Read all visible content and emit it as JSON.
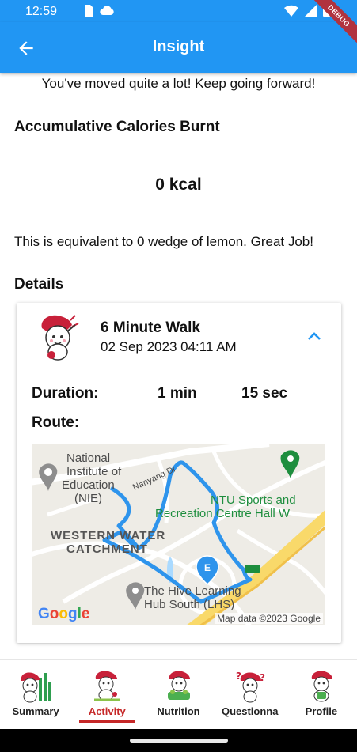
{
  "status_bar": {
    "time": "12:59"
  },
  "app_bar": {
    "title": "Insight",
    "debug_banner": "DEBUG"
  },
  "insight": {
    "motivation": "You've moved quite a lot! Keep going forward!",
    "calories_heading": "Accumulative Calories Burnt",
    "calories_value": "0 kcal",
    "equivalent_text": "This is equivalent to 0 wedge of lemon. Great Job!",
    "details_heading": "Details"
  },
  "activity": {
    "name": "6 Minute Walk",
    "datetime": "02 Sep 2023 04:11 AM",
    "duration_label": "Duration:",
    "duration_min": "1 min",
    "duration_sec": "15 sec",
    "route_label": "Route:"
  },
  "map": {
    "label_nie": "National Institute of Education (NIE)",
    "label_nie_line1": "National",
    "label_nie_line2": "Institute of",
    "label_nie_line3": "Education",
    "label_nie_line4": "(NIE)",
    "label_ntu_line1": "NTU Sports and",
    "label_ntu_line2": "Recreation Centre Hall W",
    "label_catchment_line1": "WESTERN WATER",
    "label_catchment_line2": "CATCHMENT",
    "label_hive_line1": "The Hive Learning",
    "label_hive_line2": "Hub South (LHS)",
    "road_label": "Nanyang Dr",
    "end_marker": "E",
    "logo": "Google",
    "attribution": "Map data ©2023 Google",
    "route_color": "#2e94ec"
  },
  "bottom_nav": {
    "items": [
      {
        "label": "Summary"
      },
      {
        "label": "Activity"
      },
      {
        "label": "Nutrition"
      },
      {
        "label": "Questionna"
      },
      {
        "label": "Profile"
      }
    ],
    "active_index": 1,
    "active_color": "#c62828"
  },
  "colors": {
    "primary": "#2196f3",
    "accent": "#c62828"
  },
  "icons": {
    "back": "arrow-left-icon",
    "collapse": "chevron-up-icon",
    "status": [
      "sim-card-icon",
      "cloud-icon",
      "wifi-icon",
      "signal-icon",
      "battery-icon"
    ]
  }
}
